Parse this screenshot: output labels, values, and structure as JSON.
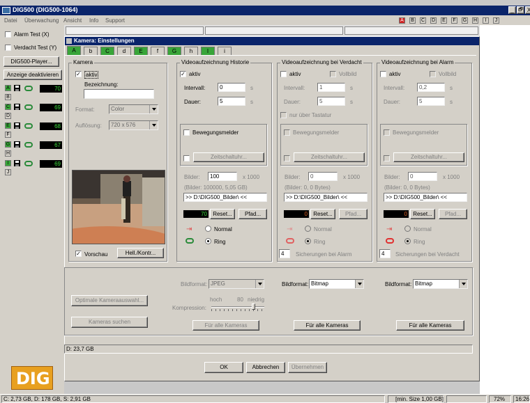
{
  "app": {
    "title": "DIG500 (DIG500-1064)",
    "menu": [
      "Datei",
      "Überwachung",
      "Ansicht",
      "Info",
      "Support"
    ],
    "letters": [
      "A",
      "B",
      "C",
      "D",
      "E",
      "F",
      "G",
      "H",
      "I",
      "J"
    ],
    "win_btns": [
      "_",
      "🗗",
      "X"
    ]
  },
  "left": {
    "alarm_test": "Alarm Test (X)",
    "verdacht_test": "Verdacht Test (Y)",
    "player_btn": "DIG500-Player...",
    "anzeige_btn": "Anzeige deaktivieren",
    "cams": [
      {
        "l": "A",
        "v": "70",
        "active": true
      },
      {
        "l": "B",
        "v": "",
        "active": false
      },
      {
        "l": "C",
        "v": "69",
        "active": true
      },
      {
        "l": "D",
        "v": "",
        "active": false
      },
      {
        "l": "E",
        "v": "68",
        "active": true
      },
      {
        "l": "F",
        "v": "",
        "active": false
      },
      {
        "l": "G",
        "v": "67",
        "active": true
      },
      {
        "l": "H",
        "v": "",
        "active": false
      },
      {
        "l": "I",
        "v": "69",
        "active": true
      },
      {
        "l": "J",
        "v": "",
        "active": false
      }
    ],
    "logo": "DIG"
  },
  "dialog": {
    "title": "Kamera: Einstellungen",
    "tabs": [
      "A",
      "b",
      "C",
      "d",
      "E",
      "f",
      "G",
      "h",
      "I",
      "i"
    ],
    "kamera": {
      "title": "Kamera",
      "aktiv": "aktiv",
      "bez_label": "Bezeichnung:",
      "bez_value": "",
      "format_label": "Format:",
      "format_value": "Color",
      "aufl_label": "Auflösung:",
      "aufl_value": "720 x 576",
      "vorschau": "Vorschau",
      "hell_btn": "Hell./Kontr..."
    },
    "hist": {
      "title": "Videoaufzeichnung Historie",
      "aktiv": "aktiv",
      "intervall_label": "Intervall:",
      "intervall_value": "0",
      "intervall_unit": "s",
      "dauer_label": "Dauer:",
      "dauer_value": "5",
      "dauer_unit": "s",
      "bew": "Bewegungsmelder",
      "zeit_btn": "Zeitschaltuhr...",
      "bilder_label": "Bilder:",
      "bilder_value": "100",
      "bilder_mult": "x 1000",
      "bilder_info": "(Bilder: 100000, 5,05 GB)",
      "path": ">> D:\\DIG500_Bilder\\ <<",
      "counter": "70",
      "reset_btn": "Reset...",
      "pfad_btn": "Pfad...",
      "normal": "Normal",
      "ring": "Ring"
    },
    "verd": {
      "title": "Videoaufzeichnung bei Verdacht",
      "aktiv": "aktiv",
      "vollbild": "Vollbild",
      "intervall_label": "Intervall:",
      "intervall_value": "1",
      "intervall_unit": "s",
      "dauer_label": "Dauer:",
      "dauer_value": "5",
      "dauer_unit": "s",
      "tastatur": "nur über Tastatur",
      "bew": "Bewegungsmelder",
      "zeit_btn": "Zeitschaltuhr...",
      "bilder_label": "Bilder:",
      "bilder_value": "0",
      "bilder_mult": "x 1000",
      "bilder_info": "(Bilder: 0, 0 Bytes)",
      "path": ">> D:\\DIG500_Bilder\\ <<",
      "counter": "0",
      "reset_btn": "Reset...",
      "pfad_btn": "Pfad...",
      "normal": "Normal",
      "ring": "Ring",
      "sich_value": "4",
      "sich_label": "Sicherungen bei Alarm"
    },
    "alarm": {
      "title": "Videoaufzeichnung bei Alarm",
      "aktiv": "aktiv",
      "vollbild": "Vollbild",
      "intervall_label": "Intervall:",
      "intervall_value": "0,2",
      "intervall_unit": "s",
      "dauer_label": "Dauer:",
      "dauer_value": "5",
      "dauer_unit": "s",
      "bew": "Bewegungsmelder",
      "zeit_btn": "Zeitschaltuhr...",
      "bilder_label": "Bilder:",
      "bilder_value": "0",
      "bilder_mult": "x 1000",
      "bilder_info": "(Bilder: 0, 0 Bytes)",
      "path": ">> D:\\DIG500_Bilder\\ <<",
      "counter": "0",
      "reset_btn": "Reset...",
      "pfad_btn": "Pfad...",
      "normal": "Normal",
      "ring": "Ring",
      "sich_value": "4",
      "sich_label": "Sicherungen bei Verdacht"
    },
    "bottom": {
      "optimale_btn": "Optimale Kameraauswahl...",
      "suchen_btn": "Kameras suchen",
      "bildformat_label": "Bildformat:",
      "bildformat1": "JPEG",
      "hoch": "hoch",
      "kompression_label": "Kompression:",
      "kompression_value": "80",
      "niedrig": "niedrig",
      "alle1": "Für alle Kameras",
      "bildformat2": "Bitmap",
      "alle2": "Für alle Kameras",
      "bildformat3": "Bitmap",
      "alle3": "Für alle Kameras"
    },
    "disk": "D: 23,7 GB",
    "ok_btn": "OK",
    "abbrechen_btn": "Abbrechen",
    "uebernehmen_btn": "Übernehmen"
  },
  "status": {
    "left": "C: 2,73 GB, D: 178 GB, S: 2,91 GB",
    "min_size": "[min. Size 1,00 GB]",
    "zoom": "72%",
    "time": "16:26"
  },
  "colors": {
    "title_bar": "#0a246a",
    "tab_green": "#39a539",
    "counter_green": "#3ddc3d",
    "logo_orange": "#f0a020",
    "letter_red": "#d02020"
  }
}
